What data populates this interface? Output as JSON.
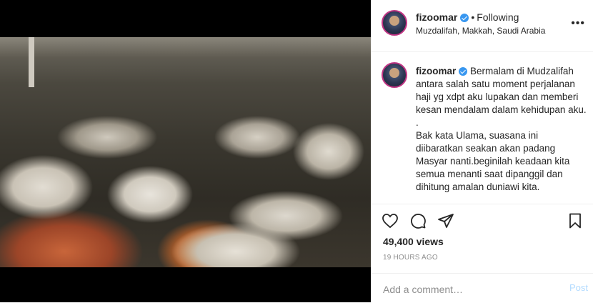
{
  "post": {
    "username": "fizoomar",
    "follow_status": "Following",
    "location": "Muzdalifah, Makkah, Saudi Arabia",
    "more_icon": "more-options-icon"
  },
  "caption": {
    "username": "fizoomar",
    "paragraphs": [
      "Bermalam di Mudzalifah antara salah satu moment perjalanan haji yg xdpt aku lupakan dan memberi kesan mendalam dalam kehidupan aku.",
      ".",
      "Bak kata Ulama, suasana ini diibaratkan seakan akan padang Masyar nanti.beginilah keadaan kita semua menanti saat dipanggil dan dihitung amalan duniawi kita."
    ]
  },
  "actions": {
    "icons": [
      "heart-icon",
      "comment-icon",
      "share-icon",
      "save-icon"
    ],
    "views": "49,400 views",
    "time": "19 HOURS AGO"
  },
  "comment": {
    "placeholder": "Add a comment…",
    "post_label": "Post"
  },
  "colors": {
    "verified": "#3897f0",
    "post_disabled": "#b3dbff",
    "secondary_text": "#8e8e8e"
  }
}
